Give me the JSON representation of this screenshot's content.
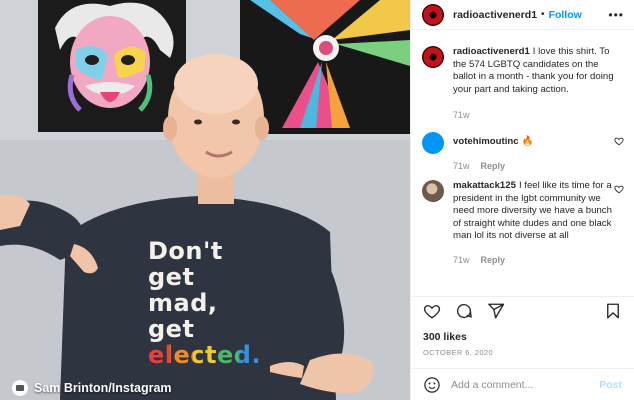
{
  "photo": {
    "shirt_lines": [
      "Don't",
      "get",
      "mad,",
      "get",
      "elected."
    ],
    "credit": "Sam Brinton/Instagram"
  },
  "header": {
    "username": "radioactivenerd1",
    "separator": "•",
    "follow_label": "Follow",
    "more_icon": "more-horizontal-icon"
  },
  "comments": [
    {
      "username": "radioactivenerd1",
      "text": "I love this shirt. To the 574 LGBTQ candidates on the ballot in a month - thank you for doing your part and taking action.",
      "time": "71w"
    },
    {
      "username": "votehimoutinc",
      "text": "🔥",
      "time": "71w",
      "reply_label": "Reply"
    },
    {
      "username": "makattack125",
      "text": "I feel like its time for a president in the lgbt community we need more diversity we have a bunch of straight white dudes and one black man lol its not diverse at all",
      "time": "71w",
      "reply_label": "Reply"
    }
  ],
  "actions": {
    "icons": [
      "heart-icon",
      "comment-icon",
      "share-icon",
      "bookmark-icon"
    ]
  },
  "likes": "300 likes",
  "date": "OCTOBER 6, 2020",
  "composer": {
    "placeholder": "Add a comment...",
    "post_label": "Post"
  },
  "colors": {
    "accent": "#0095f6",
    "post_disabled": "#b2dffc",
    "muted": "#8e8e8e"
  }
}
